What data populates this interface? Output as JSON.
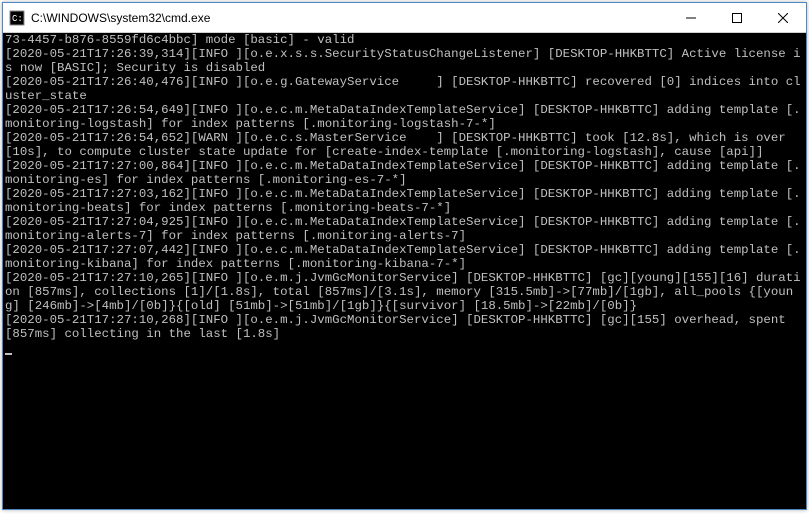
{
  "window": {
    "title": "C:\\WINDOWS\\system32\\cmd.exe"
  },
  "console": {
    "lines": [
      "73-4457-b876-8559fd6c4bbc] mode [basic] - valid",
      "[2020-05-21T17:26:39,314][INFO ][o.e.x.s.s.SecurityStatusChangeListener] [DESKTOP-HHKBTTC] Active license is now [BASIC]; Security is disabled",
      "[2020-05-21T17:26:40,476][INFO ][o.e.g.GatewayService     ] [DESKTOP-HHKBTTC] recovered [0] indices into cluster_state",
      "[2020-05-21T17:26:54,649][INFO ][o.e.c.m.MetaDataIndexTemplateService] [DESKTOP-HHKBTTC] adding template [.monitoring-logstash] for index patterns [.monitoring-logstash-7-*]",
      "[2020-05-21T17:26:54,652][WARN ][o.e.c.s.MasterService    ] [DESKTOP-HHKBTTC] took [12.8s], which is over [10s], to compute cluster state update for [create-index-template [.monitoring-logstash], cause [api]]",
      "[2020-05-21T17:27:00,864][INFO ][o.e.c.m.MetaDataIndexTemplateService] [DESKTOP-HHKBTTC] adding template [.monitoring-es] for index patterns [.monitoring-es-7-*]",
      "[2020-05-21T17:27:03,162][INFO ][o.e.c.m.MetaDataIndexTemplateService] [DESKTOP-HHKBTTC] adding template [.monitoring-beats] for index patterns [.monitoring-beats-7-*]",
      "[2020-05-21T17:27:04,925][INFO ][o.e.c.m.MetaDataIndexTemplateService] [DESKTOP-HHKBTTC] adding template [.monitoring-alerts-7] for index patterns [.monitoring-alerts-7]",
      "[2020-05-21T17:27:07,442][INFO ][o.e.c.m.MetaDataIndexTemplateService] [DESKTOP-HHKBTTC] adding template [.monitoring-kibana] for index patterns [.monitoring-kibana-7-*]",
      "[2020-05-21T17:27:10,265][INFO ][o.e.m.j.JvmGcMonitorService] [DESKTOP-HHKBTTC] [gc][young][155][16] duration [857ms], collections [1]/[1.8s], total [857ms]/[3.1s], memory [315.5mb]->[77mb]/[1gb], all_pools {[young] [246mb]->[4mb]/[0b]}{[old] [51mb]->[51mb]/[1gb]}{[survivor] [18.5mb]->[22mb]/[0b]}",
      "[2020-05-21T17:27:10,268][INFO ][o.e.m.j.JvmGcMonitorService] [DESKTOP-HHKBTTC] [gc][155] overhead, spent [857ms] collecting in the last [1.8s]"
    ]
  }
}
